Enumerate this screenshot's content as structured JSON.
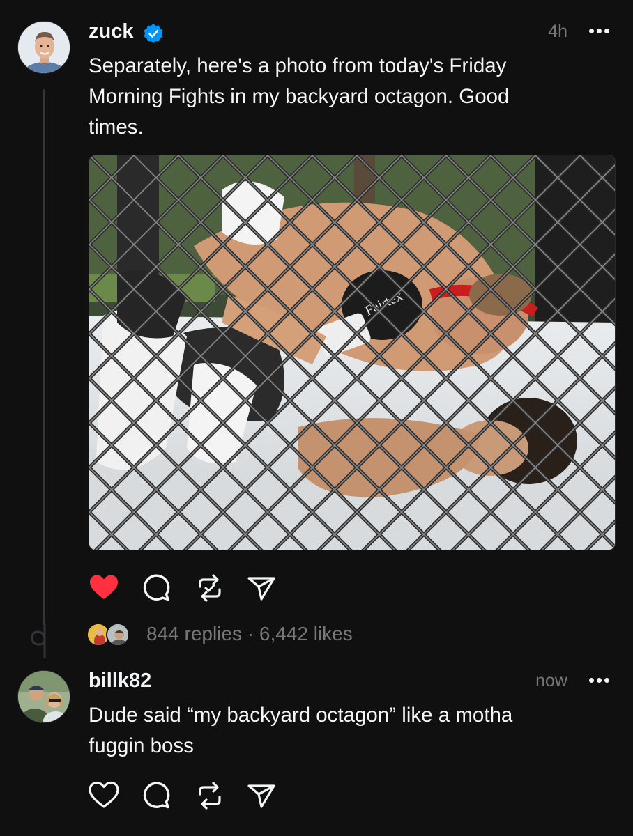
{
  "post": {
    "username": "zuck",
    "verified": true,
    "time": "4h",
    "text_lines": [
      "Separately, here's a photo from today's Friday",
      "Morning Fights in my backyard octagon. Good",
      "times."
    ],
    "photo_alt": "Photo",
    "replies": "844 replies",
    "separator": "·",
    "likes": "6,442 likes",
    "liked": true
  },
  "reply": {
    "username": "billk82",
    "time": "now",
    "text_lines": [
      "Dude said “my backyard octagon” like a motha",
      "fuggin boss"
    ]
  },
  "icons": {
    "like": "heart-icon",
    "comment": "speech-bubble-icon",
    "repost": "repost-icon",
    "share": "send-icon",
    "more": "more-horizontal-icon",
    "verified": "verified-badge-icon"
  },
  "colors": {
    "background": "#101010",
    "text": "#f3f5f7",
    "muted": "#777777",
    "liked_heart": "#ff3040",
    "verified": "#0095f6"
  }
}
